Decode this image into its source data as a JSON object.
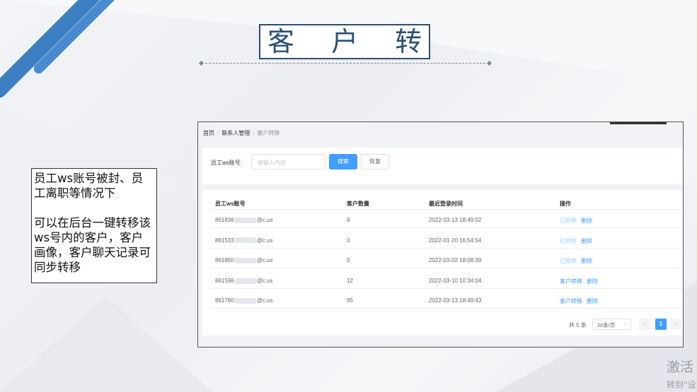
{
  "slide": {
    "title": "客 户 转 移",
    "note_line1": "员工ws账号被封、员工离职等情况下",
    "note_line2": "可以在后台一键转移该ws号内的客户，客户画像，客户聊天记录可同步转移"
  },
  "app": {
    "breadcrumb": [
      "首页",
      "联系人管理",
      "客户转移"
    ],
    "breadcrumb_sep": "/",
    "search": {
      "label": "员工ws账号:",
      "placeholder": "请输入内容",
      "search_button": "搜索",
      "reset_button": "恢复"
    },
    "table": {
      "headers": [
        "员工ws账号",
        "客户数量",
        "最近登录时间",
        "操作"
      ],
      "rows": [
        {
          "account_prefix": "861836",
          "account_suffix": "@c.us",
          "count": "9",
          "last_login": "2022-03-13 18:49:02",
          "op_transfer": "已转移",
          "op_delete": "删除",
          "transferred": true
        },
        {
          "account_prefix": "861533",
          "account_suffix": "@c.us",
          "count": "0",
          "last_login": "2022-01-20 16:54:54",
          "op_transfer": "已转移",
          "op_delete": "删除",
          "transferred": true
        },
        {
          "account_prefix": "861860",
          "account_suffix": "@c.us",
          "count": "0",
          "last_login": "2022-03-02 18:08:39",
          "op_transfer": "已转移",
          "op_delete": "删除",
          "transferred": true
        },
        {
          "account_prefix": "861596",
          "account_suffix": "@c.us",
          "count": "12",
          "last_login": "2022-03-10 10:34:04",
          "op_transfer": "客户转移",
          "op_delete": "删除",
          "transferred": false
        },
        {
          "account_prefix": "861780",
          "account_suffix": "@c.us",
          "count": "95",
          "last_login": "2022-03-13 18:49:43",
          "op_transfer": "客户转移",
          "op_delete": "删除",
          "transferred": false
        }
      ]
    },
    "pagination": {
      "total": "共 5 条",
      "page_size": "20条/页",
      "current_page": "1"
    }
  },
  "watermark": {
    "line1": "激活",
    "line2": "转到\"设"
  },
  "colors": {
    "accent": "#409eff",
    "title_border": "#2b4f72",
    "stripe": "#3c7fc3"
  }
}
